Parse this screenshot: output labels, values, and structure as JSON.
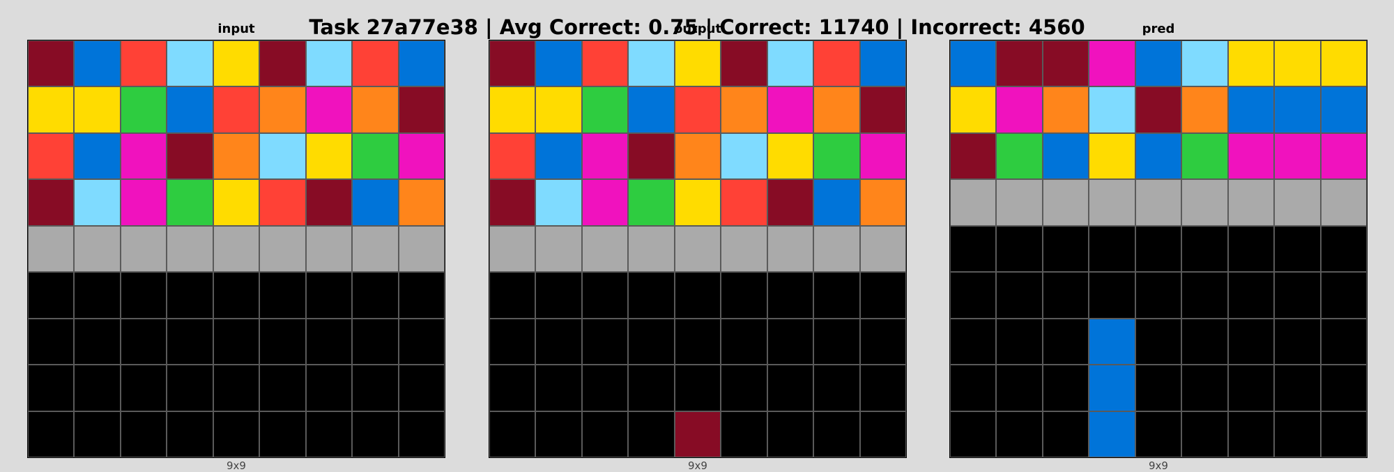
{
  "title": "Task 27a77e38 | Avg Correct: 0.75 | Correct: 11740 | Incorrect: 4560",
  "palette": {
    "0": "#000000",
    "1": "#0074D9",
    "2": "#FF4136",
    "3": "#2ECC40",
    "4": "#FFDC00",
    "5": "#AAAAAA",
    "6": "#F012BE",
    "7": "#FF851B",
    "8": "#7FDBFF",
    "9": "#870C25"
  },
  "panels": [
    {
      "label": "input",
      "dims": "9x9",
      "grid": [
        [
          9,
          1,
          2,
          8,
          4,
          9,
          8,
          2,
          1
        ],
        [
          4,
          4,
          3,
          1,
          2,
          7,
          6,
          7,
          9
        ],
        [
          2,
          1,
          6,
          9,
          7,
          8,
          4,
          3,
          6
        ],
        [
          9,
          8,
          6,
          3,
          4,
          2,
          9,
          1,
          7
        ],
        [
          5,
          5,
          5,
          5,
          5,
          5,
          5,
          5,
          5
        ],
        [
          0,
          0,
          0,
          0,
          0,
          0,
          0,
          0,
          0
        ],
        [
          0,
          0,
          0,
          0,
          0,
          0,
          0,
          0,
          0
        ],
        [
          0,
          0,
          0,
          0,
          0,
          0,
          0,
          0,
          0
        ],
        [
          0,
          0,
          0,
          0,
          0,
          0,
          0,
          0,
          0
        ]
      ]
    },
    {
      "label": "output",
      "dims": "9x9",
      "grid": [
        [
          9,
          1,
          2,
          8,
          4,
          9,
          8,
          2,
          1
        ],
        [
          4,
          4,
          3,
          1,
          2,
          7,
          6,
          7,
          9
        ],
        [
          2,
          1,
          6,
          9,
          7,
          8,
          4,
          3,
          6
        ],
        [
          9,
          8,
          6,
          3,
          4,
          2,
          9,
          1,
          7
        ],
        [
          5,
          5,
          5,
          5,
          5,
          5,
          5,
          5,
          5
        ],
        [
          0,
          0,
          0,
          0,
          0,
          0,
          0,
          0,
          0
        ],
        [
          0,
          0,
          0,
          0,
          0,
          0,
          0,
          0,
          0
        ],
        [
          0,
          0,
          0,
          0,
          0,
          0,
          0,
          0,
          0
        ],
        [
          0,
          0,
          0,
          0,
          9,
          0,
          0,
          0,
          0
        ]
      ]
    },
    {
      "label": "pred",
      "dims": "9x9",
      "grid": [
        [
          1,
          9,
          9,
          6,
          1,
          8,
          4,
          4,
          4
        ],
        [
          4,
          6,
          7,
          8,
          9,
          7,
          1,
          1,
          1
        ],
        [
          9,
          3,
          1,
          4,
          1,
          3,
          6,
          6,
          6
        ],
        [
          5,
          5,
          5,
          5,
          5,
          5,
          5,
          5,
          5
        ],
        [
          0,
          0,
          0,
          0,
          0,
          0,
          0,
          0,
          0
        ],
        [
          0,
          0,
          0,
          0,
          0,
          0,
          0,
          0,
          0
        ],
        [
          0,
          0,
          0,
          1,
          0,
          0,
          0,
          0,
          0
        ],
        [
          0,
          0,
          0,
          1,
          0,
          0,
          0,
          0,
          0
        ],
        [
          0,
          0,
          0,
          1,
          0,
          0,
          0,
          0,
          0
        ]
      ]
    }
  ]
}
